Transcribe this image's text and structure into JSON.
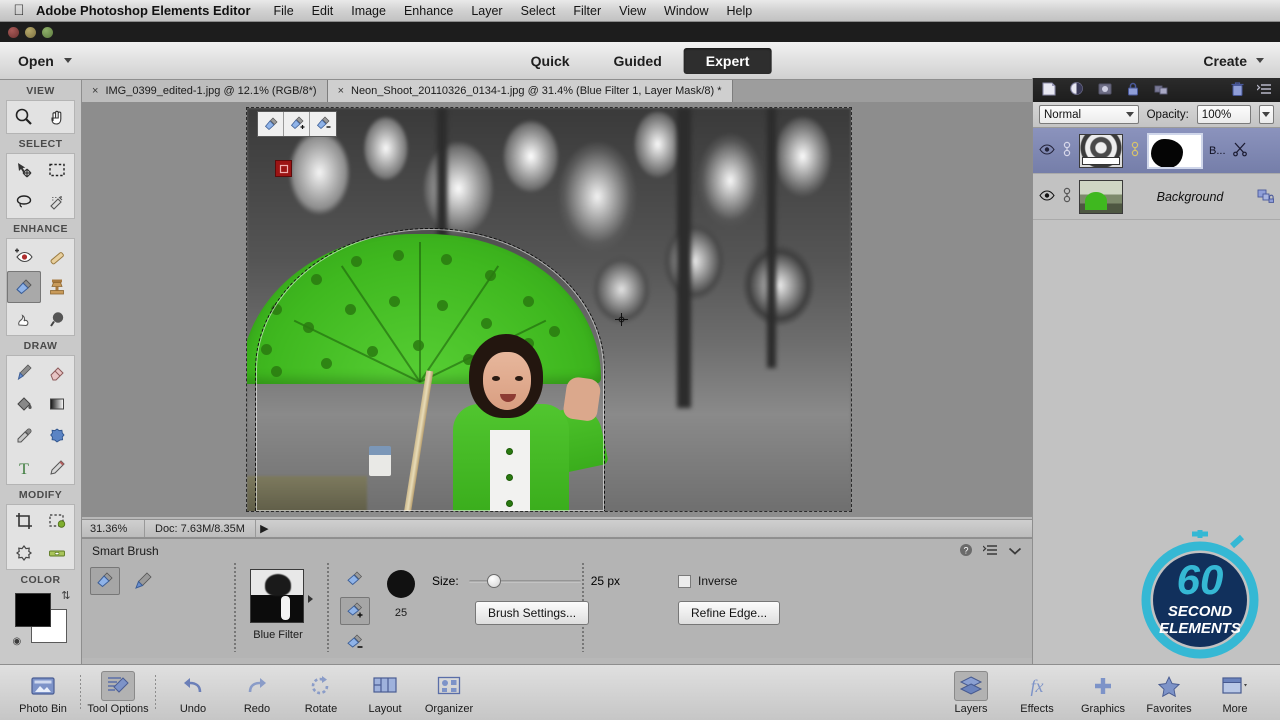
{
  "os": {
    "apple_icon": "apple-icon",
    "app_name": "Adobe Photoshop Elements Editor",
    "menus": [
      "File",
      "Edit",
      "Image",
      "Enhance",
      "Layer",
      "Select",
      "Filter",
      "View",
      "Window",
      "Help"
    ]
  },
  "topbar": {
    "open_label": "Open",
    "modes": [
      {
        "label": "Quick",
        "active": false
      },
      {
        "label": "Guided",
        "active": false
      },
      {
        "label": "Expert",
        "active": true
      }
    ],
    "create_label": "Create"
  },
  "tabs": [
    {
      "close": "×",
      "title": "IMG_0399_edited-1.jpg @ 12.1% (RGB/8*)",
      "active": false
    },
    {
      "close": "×",
      "title": "Neon_Shoot_20110326_0134-1.jpg @ 31.4% (Blue Filter 1, Layer Mask/8) *",
      "active": true
    }
  ],
  "toolbox": {
    "sections": [
      {
        "label": "VIEW",
        "tools": [
          "zoom-tool",
          "hand-tool"
        ]
      },
      {
        "label": "SELECT",
        "tools": [
          "move-tool",
          "rectangular-marquee-tool",
          "lasso-tool",
          "quick-selection-tool"
        ]
      },
      {
        "label": "ENHANCE",
        "tools": [
          "red-eye-removal-tool",
          "spot-healing-brush-tool",
          "smart-brush-tool",
          "clone-stamp-tool",
          "smudge-tool",
          "blur-tool"
        ]
      },
      {
        "label": "DRAW",
        "tools": [
          "brush-tool",
          "eraser-tool",
          "paint-bucket-tool",
          "gradient-tool",
          "eyedropper-tool",
          "cookie-cutter-tool",
          "type-tool",
          "pencil-tool"
        ]
      },
      {
        "label": "MODIFY",
        "tools": [
          "crop-tool",
          "recompose-tool",
          "content-aware-move-tool",
          "straighten-tool"
        ]
      },
      {
        "label": "COLOR",
        "tools": [
          "foreground-color-swatch",
          "background-color-swatch"
        ]
      }
    ],
    "selected_tool": "smart-brush-tool",
    "foreground_color": "#000000",
    "background_color": "#ffffff"
  },
  "canvas": {
    "on_canvas_tools": [
      "smart-brush-new",
      "smart-brush-add",
      "smart-brush-subtract"
    ],
    "pin_marker": "selection-pin-marker",
    "cursor": "move-cursor"
  },
  "statusbar": {
    "zoom": "31.36%",
    "doc_info": "Doc: 7.63M/8.35M",
    "arrow": "▶"
  },
  "tool_options": {
    "title": "Smart Brush",
    "help_icon": "help-icon",
    "menu_icon": "panel-menu-icon",
    "collapse_icon": "chevron-down-icon",
    "brush_types": [
      "smart-brush",
      "detail-smart-brush"
    ],
    "selected_brush_type": "smart-brush",
    "preset_label": "Blue Filter",
    "selection_modes": [
      "new-selection",
      "add-to-selection",
      "subtract-from-selection"
    ],
    "selected_selection_mode": "add-to-selection",
    "brush_preview_size": "25",
    "size_label": "Size:",
    "size_value": "25 px",
    "brush_settings_label": "Brush Settings...",
    "inverse_label": "Inverse",
    "inverse_checked": false,
    "refine_edge_label": "Refine Edge..."
  },
  "layers_panel": {
    "toolbar_icons": [
      "new-layer-icon",
      "new-adjustment-layer-icon",
      "add-layer-mask-icon",
      "lock-icon",
      "link-layers-icon",
      "delete-layer-icon",
      "panel-menu-icon"
    ],
    "blend_mode": "Normal",
    "opacity_label": "Opacity:",
    "opacity_value": "100%",
    "layers": [
      {
        "name": "",
        "short_name": "B...",
        "visible_icon": "eye-icon",
        "link_icon": "link-icon",
        "thumbnail": "adjustment-layer-thumbnail",
        "mask_thumbnail": "layer-mask-thumbnail",
        "extra_icon": "scissors-clipping-icon",
        "selected": true
      },
      {
        "name": "Background",
        "short_name": "",
        "visible_icon": "eye-icon",
        "link_icon": "link-icon",
        "thumbnail": "background-photo-thumbnail",
        "mask_thumbnail": "",
        "extra_icon": "lock-icon",
        "selected": false
      }
    ]
  },
  "taskbar": {
    "left": [
      {
        "label": "Photo Bin",
        "icon": "photo-bin-icon",
        "active": false
      },
      {
        "label": "Tool Options",
        "icon": "tool-options-icon",
        "active": true
      },
      {
        "label": "Undo",
        "icon": "undo-icon",
        "active": false
      },
      {
        "label": "Redo",
        "icon": "redo-icon",
        "active": false
      },
      {
        "label": "Rotate",
        "icon": "rotate-icon",
        "active": false
      },
      {
        "label": "Layout",
        "icon": "layout-icon",
        "active": false
      },
      {
        "label": "Organizer",
        "icon": "organizer-icon",
        "active": false
      }
    ],
    "right": [
      {
        "label": "Layers",
        "icon": "layers-icon",
        "active": true
      },
      {
        "label": "Effects",
        "icon": "effects-fx-icon",
        "active": false
      },
      {
        "label": "Graphics",
        "icon": "graphics-plus-icon",
        "active": false
      },
      {
        "label": "Favorites",
        "icon": "favorites-star-icon",
        "active": false
      },
      {
        "label": "More",
        "icon": "more-panel-icon",
        "active": false
      }
    ]
  },
  "watermark": {
    "number": "60",
    "line1": "SECOND",
    "line2": "ELEMENTS",
    "ring_color": "#35b8d4",
    "fill_color": "#11305c"
  }
}
